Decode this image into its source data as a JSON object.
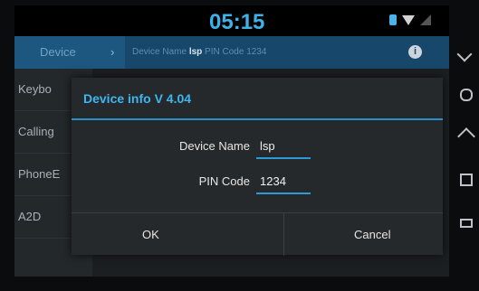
{
  "status": {
    "time": "05:15"
  },
  "header": {
    "tab": "Device",
    "arrow": "›",
    "device_name_label": "Device Name",
    "device_name_value": "lsp",
    "pin_label": "PIN Code",
    "pin_value": "1234",
    "info_icon": "i"
  },
  "sidebar": {
    "items": [
      "Keybo",
      "Calling",
      "PhoneE",
      "A2D"
    ]
  },
  "dialog": {
    "title": "Device info  V 4.04",
    "device_name_label": "Device Name",
    "device_name_value": "lsp",
    "pin_label": "PIN Code",
    "pin_value": "1234",
    "ok": "OK",
    "cancel": "Cancel"
  },
  "icons": {
    "check": "✓"
  }
}
